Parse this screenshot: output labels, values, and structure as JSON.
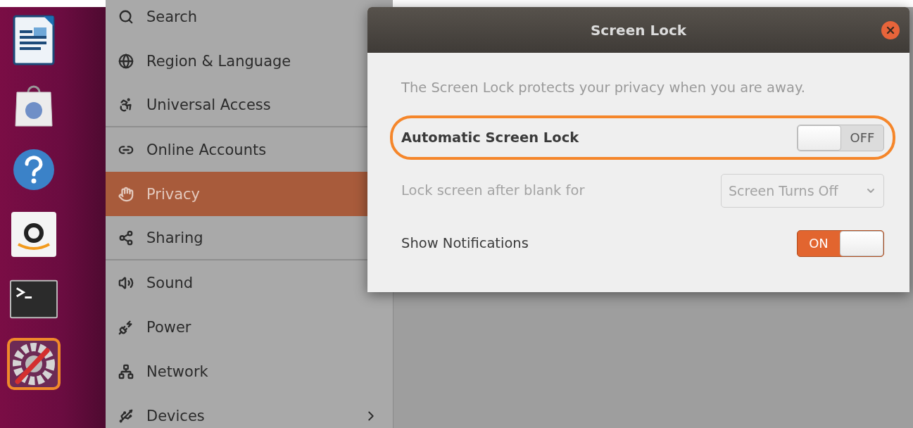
{
  "dock": {
    "items": [
      {
        "kind": "writer",
        "highlighted": false
      },
      {
        "kind": "store",
        "highlighted": false
      },
      {
        "kind": "help",
        "highlighted": false
      },
      {
        "kind": "amazon",
        "highlighted": false
      },
      {
        "kind": "terminal",
        "highlighted": false
      },
      {
        "kind": "settings",
        "highlighted": true
      }
    ]
  },
  "sidebar": {
    "items": [
      {
        "label": "Search",
        "selected": false,
        "separator_after": false
      },
      {
        "label": "Region & Language",
        "selected": false,
        "separator_after": false
      },
      {
        "label": "Universal Access",
        "selected": false,
        "separator_after": true
      },
      {
        "label": "Online Accounts",
        "selected": false,
        "separator_after": false
      },
      {
        "label": "Privacy",
        "selected": true,
        "separator_after": false
      },
      {
        "label": "Sharing",
        "selected": false,
        "separator_after": true
      },
      {
        "label": "Sound",
        "selected": false,
        "separator_after": false
      },
      {
        "label": "Power",
        "selected": false,
        "separator_after": false
      },
      {
        "label": "Network",
        "selected": false,
        "separator_after": false
      },
      {
        "label": "Devices",
        "selected": false,
        "separator_after": false,
        "has_submenu": true
      }
    ]
  },
  "dialog": {
    "title": "Screen Lock",
    "description": "The Screen Lock protects your privacy when you are away.",
    "rows": [
      {
        "kind": "toggle",
        "label": "Automatic Screen Lock",
        "bold": true,
        "on": false,
        "state_label": "OFF",
        "disabled": false,
        "highlighted": true
      },
      {
        "kind": "dropdown",
        "label": "Lock screen after blank for",
        "bold": false,
        "value": "Screen Turns Off",
        "disabled": true,
        "highlighted": false
      },
      {
        "kind": "toggle",
        "label": "Show Notifications",
        "bold": false,
        "on": true,
        "state_label": "ON",
        "disabled": false,
        "highlighted": false
      }
    ]
  }
}
